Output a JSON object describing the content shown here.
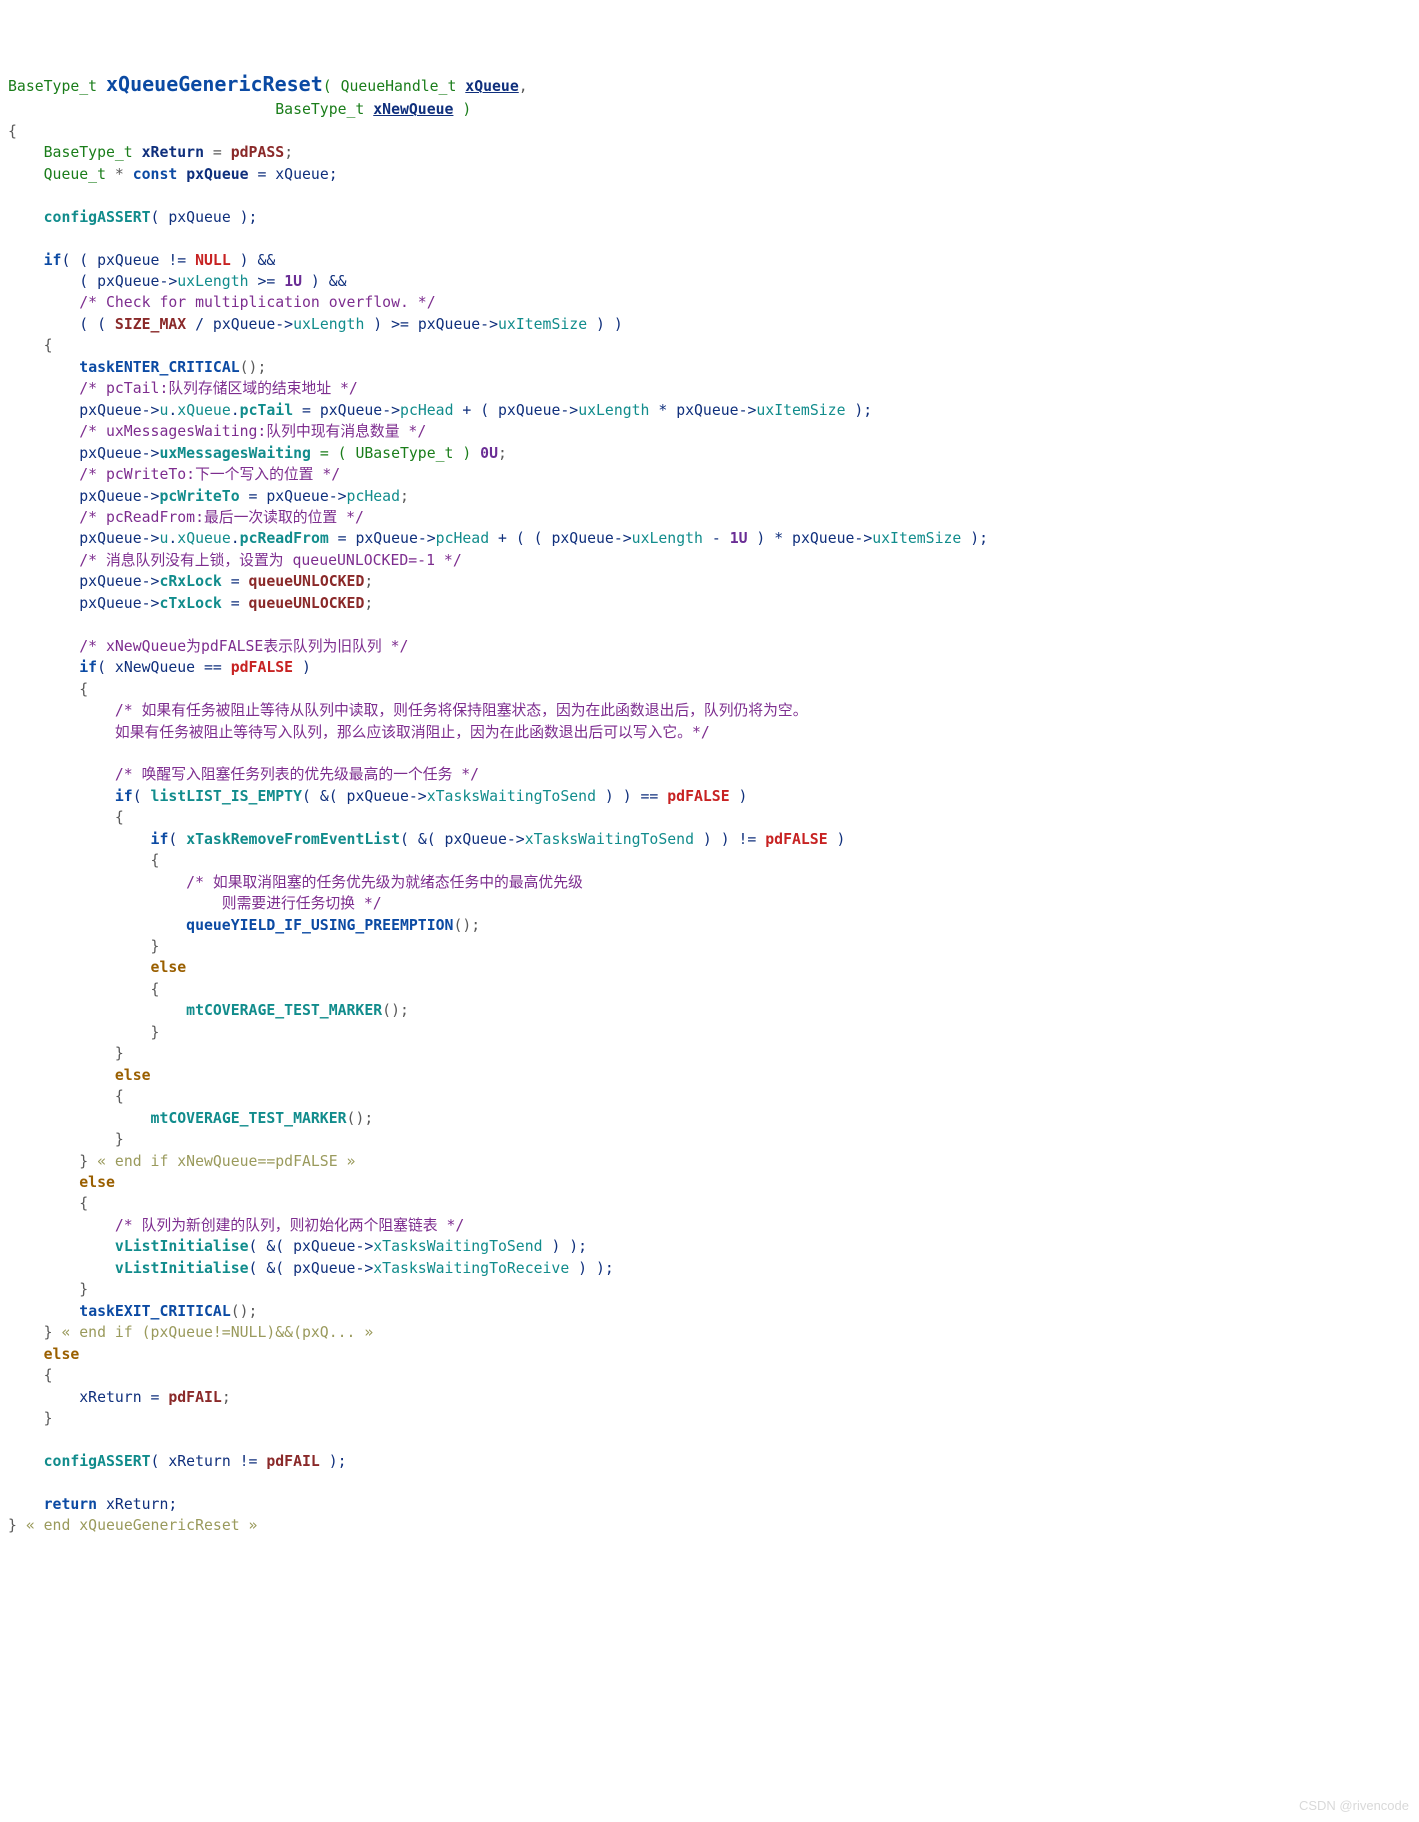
{
  "code": {
    "l01a": "BaseType_t ",
    "l01b": "xQueueGenericReset",
    "l01c": "( QueueHandle_t ",
    "l01d": "xQueue",
    "l01e": ",",
    "l02a": "                              BaseType_t ",
    "l02b": "xNewQueue",
    "l02c": " )",
    "l03": "{",
    "l04a": "    BaseType_t ",
    "l04b": "xReturn",
    "l04c": " = ",
    "l04d": "pdPASS",
    "l04e": ";",
    "l05a": "    Queue_t ",
    "l05b": "*",
    "l05c": " const ",
    "l05d": "pxQueue",
    "l05e": " = xQueue;",
    "l06": "",
    "l07a": "    ",
    "l07b": "configASSERT",
    "l07c": "( pxQueue );",
    "l08": "",
    "l09a": "    if",
    "l09b": "( ( pxQueue != ",
    "l09c": "NULL",
    "l09d": " ) &&",
    "l10a": "        ( pxQueue->",
    "l10b": "uxLength",
    "l10c": " >= ",
    "l10d": "1U",
    "l10e": " ) &&",
    "l11": "        /* Check for multiplication overflow. */",
    "l12a": "        ( ( ",
    "l12b": "SIZE_MAX",
    "l12c": " / pxQueue->",
    "l12d": "uxLength",
    "l12e": " ) >= pxQueue->",
    "l12f": "uxItemSize",
    "l12g": " ) )",
    "l13": "    {",
    "l14a": "        ",
    "l14b": "taskENTER_CRITICAL",
    "l14c": "();",
    "l15": "        /* pcTail:队列存储区域的结束地址 */",
    "l16a": "        pxQueue->",
    "l16b": "u",
    "l16c": ".",
    "l16d": "xQueue",
    "l16e": ".",
    "l16f": "pcTail",
    "l16g": " = pxQueue->",
    "l16h": "pcHead",
    "l16i": " + ( pxQueue->",
    "l16j": "uxLength",
    "l16k": " * pxQueue->",
    "l16l": "uxItemSize",
    "l16m": " );",
    "l17": "        /* uxMessagesWaiting:队列中现有消息数量 */",
    "l18a": "        pxQueue->",
    "l18b": "uxMessagesWaiting",
    "l18c": " = ( UBaseType_t ) ",
    "l18d": "0U",
    "l18e": ";",
    "l19": "        /* pcWriteTo:下一个写入的位置 */",
    "l20a": "        pxQueue->",
    "l20b": "pcWriteTo",
    "l20c": " = pxQueue->",
    "l20d": "pcHead",
    "l20e": ";",
    "l21": "        /* pcReadFrom:最后一次读取的位置 */",
    "l22a": "        pxQueue->",
    "l22b": "u",
    "l22c": ".",
    "l22d": "xQueue",
    "l22e": ".",
    "l22f": "pcReadFrom",
    "l22g": " = pxQueue->",
    "l22h": "pcHead",
    "l22i": " + ( ( pxQueue->",
    "l22j": "uxLength",
    "l22k": " - ",
    "l22l": "1U",
    "l22m": " ) * pxQueue->",
    "l22n": "uxItemSize",
    "l22o": " );",
    "l23": "        /* 消息队列没有上锁，设置为 queueUNLOCKED=-1 */",
    "l24a": "        pxQueue->",
    "l24b": "cRxLock",
    "l24c": " = ",
    "l24d": "queueUNLOCKED",
    "l24e": ";",
    "l25a": "        pxQueue->",
    "l25b": "cTxLock",
    "l25c": " = ",
    "l25d": "queueUNLOCKED",
    "l25e": ";",
    "l26": "",
    "l27": "        /* xNewQueue为pdFALSE表示队列为旧队列 */",
    "l28a": "        if",
    "l28b": "( xNewQueue == ",
    "l28c": "pdFALSE",
    "l28d": " )",
    "l29": "        {",
    "l30": "            /* 如果有任务被阻止等待从队列中读取，则任务将保持阻塞状态，因为在此函数退出后，队列仍将为空。",
    "l31": "            如果有任务被阻止等待写入队列，那么应该取消阻止，因为在此函数退出后可以写入它。*/",
    "l32": "",
    "l33": "            /* 唤醒写入阻塞任务列表的优先级最高的一个任务 */",
    "l34a": "            if",
    "l34b": "( ",
    "l34c": "listLIST_IS_EMPTY",
    "l34d": "( &( pxQueue->",
    "l34e": "xTasksWaitingToSend",
    "l34f": " ) ) == ",
    "l34g": "pdFALSE",
    "l34h": " )",
    "l35": "            {",
    "l36a": "                if",
    "l36b": "( ",
    "l36c": "xTaskRemoveFromEventList",
    "l36d": "( &( pxQueue->",
    "l36e": "xTasksWaitingToSend",
    "l36f": " ) ) != ",
    "l36g": "pdFALSE",
    "l36h": " )",
    "l37": "                {",
    "l38": "                    /* 如果取消阻塞的任务优先级为就绪态任务中的最高优先级",
    "l39": "                        则需要进行任务切换 */",
    "l40a": "                    ",
    "l40b": "queueYIELD_IF_USING_PREEMPTION",
    "l40c": "();",
    "l41": "                }",
    "l42": "                else",
    "l43": "                {",
    "l44a": "                    ",
    "l44b": "mtCOVERAGE_TEST_MARKER",
    "l44c": "();",
    "l45": "                }",
    "l46": "            }",
    "l47": "            else",
    "l48": "            {",
    "l49a": "                ",
    "l49b": "mtCOVERAGE_TEST_MARKER",
    "l49c": "();",
    "l50": "            }",
    "l51a": "        } ",
    "l51b": "« end if xNewQueue==pdFALSE »",
    "l52": "        else",
    "l53": "        {",
    "l54": "            /* 队列为新创建的队列，则初始化两个阻塞链表 */",
    "l55a": "            ",
    "l55b": "vListInitialise",
    "l55c": "( &( pxQueue->",
    "l55d": "xTasksWaitingToSend",
    "l55e": " ) );",
    "l56a": "            ",
    "l56b": "vListInitialise",
    "l56c": "( &( pxQueue->",
    "l56d": "xTasksWaitingToReceive",
    "l56e": " ) );",
    "l57": "        }",
    "l58a": "        ",
    "l58b": "taskEXIT_CRITICAL",
    "l58c": "();",
    "l59a": "    } ",
    "l59b": "« end if (pxQueue!=NULL)&&(pxQ... »",
    "l60": "    else",
    "l61": "    {",
    "l62a": "        xReturn = ",
    "l62b": "pdFAIL",
    "l62c": ";",
    "l63": "    }",
    "l64": "",
    "l65a": "    ",
    "l65b": "configASSERT",
    "l65c": "( xReturn != ",
    "l65d": "pdFAIL",
    "l65e": " );",
    "l66": "",
    "l67a": "    return",
    "l67b": " xReturn;",
    "l68a": "} ",
    "l68b": "« end xQueueGenericReset »"
  },
  "watermark": "CSDN @rivencode"
}
